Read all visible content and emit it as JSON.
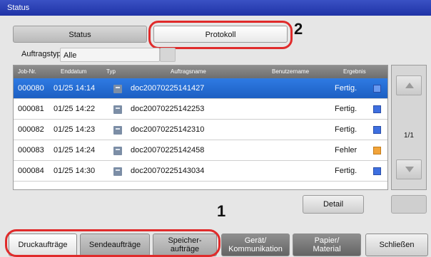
{
  "window": {
    "title": "Status"
  },
  "top_tabs": [
    {
      "label": "Status"
    },
    {
      "label": "Protokoll"
    }
  ],
  "markers": {
    "one": "1",
    "two": "2"
  },
  "filter": {
    "label": "Auftragstyp",
    "value": "Alle"
  },
  "table": {
    "headers": [
      "Job-Nr.",
      "Enddatum",
      "Typ",
      "Auftragsname",
      "Benutzername",
      "Ergebnis"
    ],
    "rows": [
      {
        "job": "000080",
        "date": "01/25 14:14",
        "name": "doc20070225141427",
        "result": "Fertig.",
        "status": "ok",
        "selected": true
      },
      {
        "job": "000081",
        "date": "01/25 14:22",
        "name": "doc20070225142253",
        "result": "Fertig.",
        "status": "ok",
        "selected": false
      },
      {
        "job": "000082",
        "date": "01/25 14:23",
        "name": "doc20070225142310",
        "result": "Fertig.",
        "status": "ok",
        "selected": false
      },
      {
        "job": "000083",
        "date": "01/25 14:24",
        "name": "doc20070225142458",
        "result": "Fehler",
        "status": "error",
        "selected": false
      },
      {
        "job": "000084",
        "date": "01/25 14:30",
        "name": "doc20070225143034",
        "result": "Fertig.",
        "status": "ok",
        "selected": false
      }
    ]
  },
  "pagination": {
    "indicator": "1/1"
  },
  "detail_label": "Detail",
  "bottom_tabs": [
    {
      "line1": "Druckaufträge",
      "line2": ""
    },
    {
      "line1": "Sendeaufträge",
      "line2": ""
    },
    {
      "line1": "Speicher-",
      "line2": "aufträge"
    },
    {
      "line1": "Gerät/",
      "line2": "Kommunikation"
    },
    {
      "line1": "Papier/",
      "line2": "Material"
    },
    {
      "line1": "Schließen",
      "line2": ""
    }
  ],
  "colors": {
    "accent": "#1c5fc2",
    "highlight": "#e02b2b",
    "title_bar": "#2a3fb8"
  }
}
